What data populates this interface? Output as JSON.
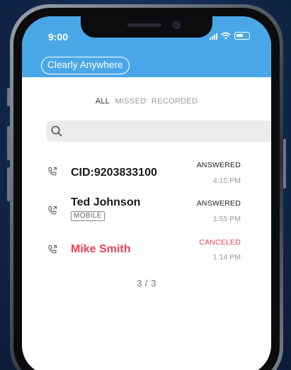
{
  "status_bar": {
    "time": "9:00"
  },
  "header": {
    "brand_label": "Clearly Anywhere"
  },
  "filters": {
    "all": "ALL",
    "missed": "MISSED",
    "recorded": "RECORDED"
  },
  "search": {
    "placeholder": ""
  },
  "calls": [
    {
      "name": "CID:9203833100",
      "tag": "",
      "status": "ANSWERED",
      "time": "4:15 PM"
    },
    {
      "name": "Ted Johnson",
      "tag": "MOBILE",
      "status": "ANSWERED",
      "time": "1:55 PM"
    },
    {
      "name": "Mike Smith",
      "tag": "",
      "status": "CANCELED",
      "time": "1:14 PM"
    }
  ],
  "pager": {
    "label": "3 / 3"
  },
  "colors": {
    "header": "#49a7e8",
    "canceled": "#e8415a",
    "background": "#13294d"
  }
}
